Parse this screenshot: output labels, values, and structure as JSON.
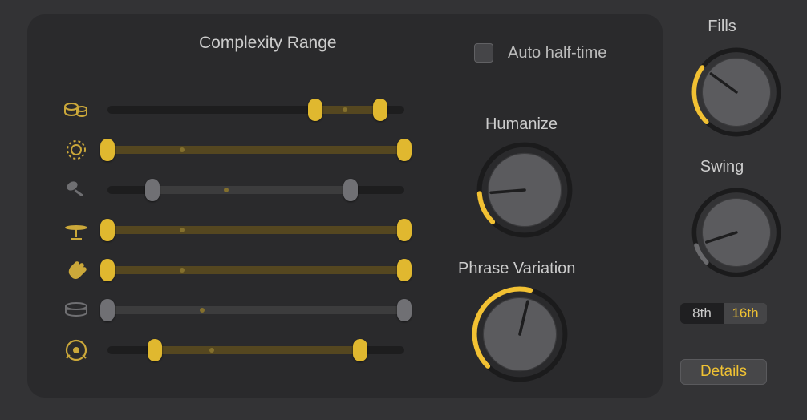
{
  "section_title": "Complexity Range",
  "auto_half_time": {
    "label": "Auto half-time",
    "checked": false
  },
  "rows": [
    {
      "icon": "bongos",
      "active": true,
      "start": 70,
      "end": 92,
      "tick": 80
    },
    {
      "icon": "tambourine",
      "active": true,
      "start": 0,
      "end": 100,
      "tick": 25
    },
    {
      "icon": "shaker",
      "active": false,
      "start": 15,
      "end": 82,
      "tick": 40
    },
    {
      "icon": "cymbal",
      "active": true,
      "start": 0,
      "end": 100,
      "tick": 25
    },
    {
      "icon": "clap",
      "active": true,
      "start": 0,
      "end": 100,
      "tick": 25
    },
    {
      "icon": "snare",
      "active": false,
      "start": 0,
      "end": 100,
      "tick": 32
    },
    {
      "icon": "kick",
      "active": true,
      "start": 16,
      "end": 85,
      "tick": 35
    }
  ],
  "humanize": {
    "label": "Humanize",
    "locked": false,
    "value": 0.15,
    "color": "#f2c133"
  },
  "phrase_variation": {
    "label": "Phrase Variation",
    "locked": false,
    "value": 0.55,
    "color": "#f2c133"
  },
  "fills": {
    "label": "Fills",
    "locked": true,
    "value": 0.3,
    "color": "#f2c133"
  },
  "swing": {
    "label": "Swing",
    "locked": false,
    "value": 0.1,
    "color": "#f2c133"
  },
  "swing_mode": {
    "options": [
      "8th",
      "16th"
    ],
    "selected": "16th"
  },
  "details_label": "Details",
  "colors": {
    "accent": "#f2c133",
    "muted": "#707074"
  }
}
